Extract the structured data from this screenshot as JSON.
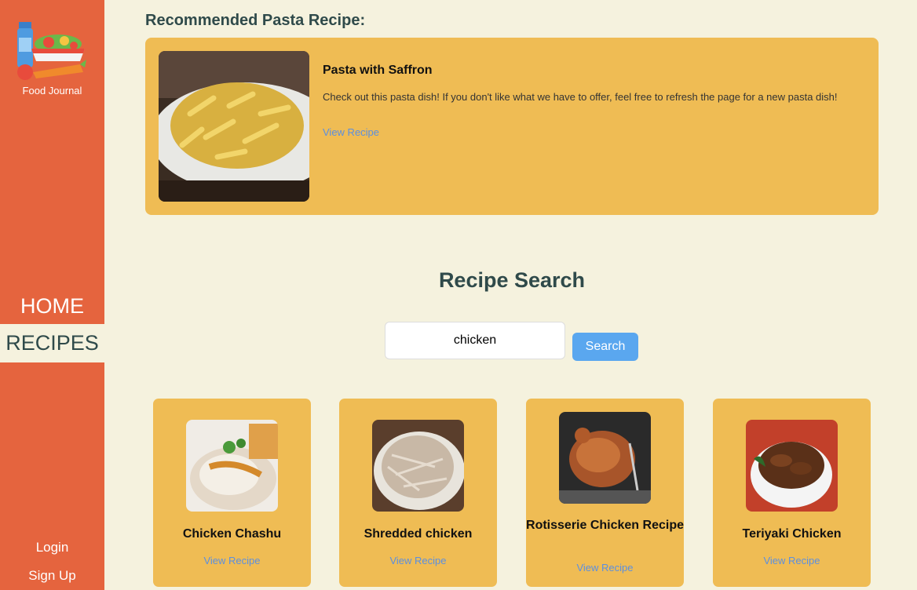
{
  "sidebar": {
    "logo_text": "Food Journal",
    "nav": {
      "home": "HOME",
      "recipes": "RECIPES"
    },
    "login": "Login",
    "signup": "Sign Up"
  },
  "recommended": {
    "heading": "Recommended Pasta Recipe:",
    "name": "Pasta with Saffron",
    "description": "Check out this pasta dish! If you don't like what we have to offer, feel free to refresh the page for a new pasta dish!",
    "link": "View Recipe"
  },
  "search": {
    "title": "Recipe Search",
    "value": "chicken",
    "button": "Search"
  },
  "results": [
    {
      "title": "Chicken Chashu",
      "link": "View Recipe"
    },
    {
      "title": "Shredded chicken",
      "link": "View Recipe"
    },
    {
      "title": "Rotisserie Chicken Recipe",
      "link": "View Recipe"
    },
    {
      "title": "Teriyaki Chicken",
      "link": "View Recipe"
    }
  ],
  "colors": {
    "sidebar": "#e5643e",
    "background": "#f5f2de",
    "card": "#efbc54",
    "link": "#5b8fe0",
    "button": "#5aa7ef"
  }
}
